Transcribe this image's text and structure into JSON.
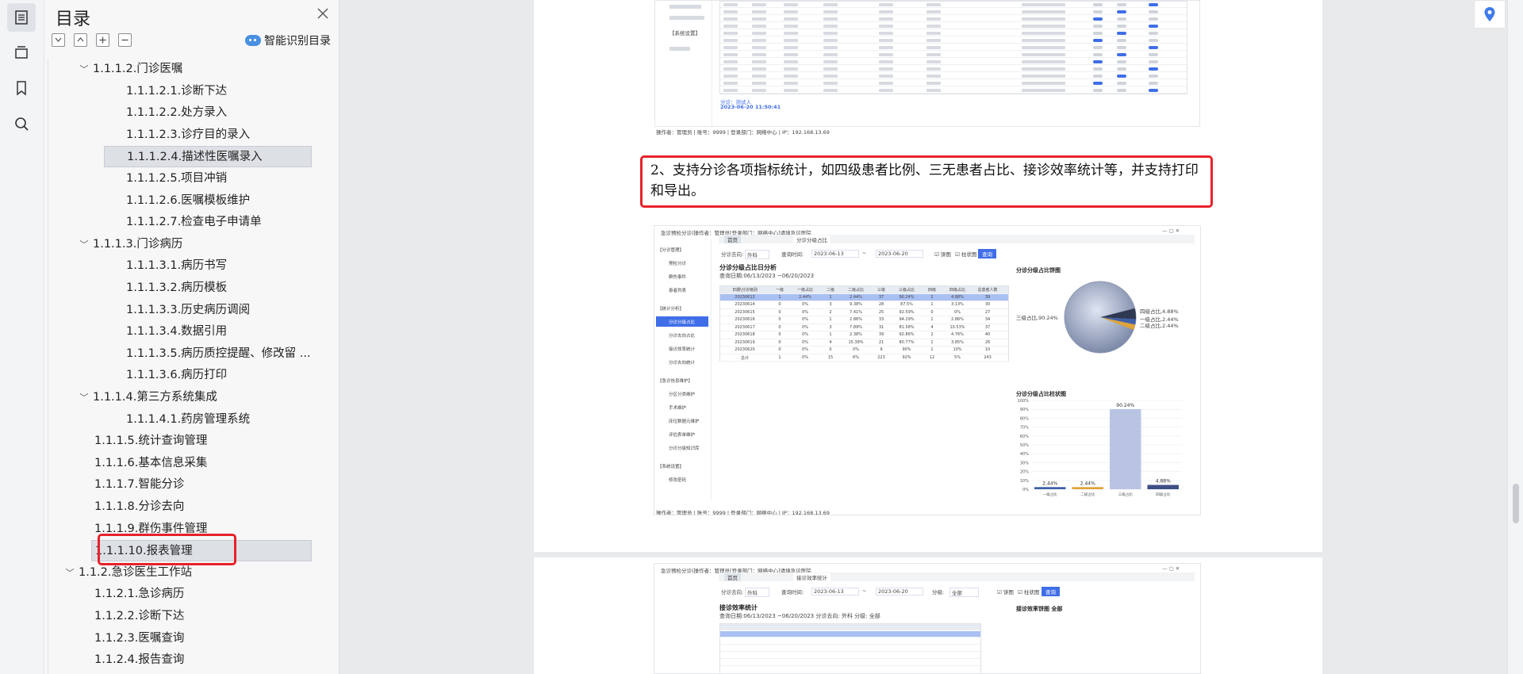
{
  "toc": {
    "title": "目录",
    "smart_label": "智能识别目录",
    "items": [
      {
        "text": "1.1.1.2.门诊医嘱",
        "level": 2,
        "expanded": true
      },
      {
        "text": "1.1.1.2.1.诊断下达",
        "level": 3
      },
      {
        "text": "1.1.1.2.2.处方录入",
        "level": 3
      },
      {
        "text": "1.1.1.2.3.诊疗目的录入",
        "level": 3
      },
      {
        "text": "1.1.1.2.4.描述性医嘱录入",
        "level": 3,
        "selected": true
      },
      {
        "text": "1.1.1.2.5.项目冲销",
        "level": 3
      },
      {
        "text": "1.1.1.2.6.医嘱模板维护",
        "level": 3
      },
      {
        "text": "1.1.1.2.7.检查电子申请单",
        "level": 3
      },
      {
        "text": "1.1.1.3.门诊病历",
        "level": 2,
        "expanded": true
      },
      {
        "text": "1.1.1.3.1.病历书写",
        "level": 3
      },
      {
        "text": "1.1.1.3.2.病历模板",
        "level": 3
      },
      {
        "text": "1.1.1.3.3.历史病历调阅",
        "level": 3
      },
      {
        "text": "1.1.1.3.4.数据引用",
        "level": 3
      },
      {
        "text": "1.1.1.3.5.病历质控提醒、修改留 ...",
        "level": 3
      },
      {
        "text": "1.1.1.3.6.病历打印",
        "level": 3
      },
      {
        "text": "1.1.1.4.第三方系统集成",
        "level": 2,
        "expanded": true
      },
      {
        "text": "1.1.1.4.1.药房管理系统",
        "level": 3
      },
      {
        "text": "1.1.1.5.统计查询管理",
        "level": 2
      },
      {
        "text": "1.1.1.6.基本信息采集",
        "level": 2
      },
      {
        "text": "1.1.1.7.智能分诊",
        "level": 2
      },
      {
        "text": "1.1.1.8.分诊去向",
        "level": 2
      },
      {
        "text": "1.1.1.9.群伤事件管理",
        "level": 2
      },
      {
        "text": "1.1.1.10.报表管理",
        "level": 2,
        "highlighted": true,
        "selected": true
      },
      {
        "text": "1.1.2.急诊医生工作站",
        "level": 1,
        "expanded": true
      },
      {
        "text": "1.1.2.1.急诊病历",
        "level": 2
      },
      {
        "text": "1.1.2.2.诊断下达",
        "level": 2
      },
      {
        "text": "1.1.2.3.医嘱查询",
        "level": 2
      },
      {
        "text": "1.1.2.4.报告查询",
        "level": 2
      }
    ]
  },
  "document": {
    "paragraph": "2、支持分诊各项指标统计，如四级患者比例、三无患者占比、接诊效率统计等，并支持打印和导出。",
    "shot1": {
      "triage_label": "分诊：测试人",
      "triage_time": "2023-06-20 11:50:41",
      "footer": "操作者：管理员 | 账号：9999 | 登录部门：网络中心 | IP：192.168.13.69"
    },
    "shot2": {
      "window_title": "急诊预检分诊(操作者：管理员[登录部门：网络中心]请填急诊医院",
      "tab_home": "首页",
      "tab_active": "分诊分级占比",
      "filter_dept_label": "分诊去向:",
      "filter_dept": "外科",
      "filter_time_label": "查询时间:",
      "date_from": "2023-06-13",
      "date_to": "2023-06-20",
      "check_pie": "饼图",
      "check_bar": "柱状图",
      "query_btn": "查询",
      "report_title": "分诊分级占比日分析",
      "report_range": "查询日期:06/13/2023 ~06/20/2023",
      "pie_title": "分诊分级占比饼图",
      "bar_title": "分诊分级占比柱状图",
      "pie_labels": {
        "l3": "三级占比,90.24%",
        "l4": "四级占比,4.88%",
        "l1": "一级占比,2.44%",
        "l2": "二级占比,2.44%"
      },
      "footer": "操作者：管理员 | 账号：9999 | 登录部门：网络中心 | IP：192.168.13.69"
    },
    "shot3": {
      "window_title": "急诊预检分诊(操作者：管理员[登录部门：网络中心]请填急诊医院",
      "tab_home": "首页",
      "tab_active": "接诊效率统计",
      "filter_dept": "外科",
      "date_from": "2023-06-13",
      "date_to": "2023-06-20",
      "level_label": "分级:",
      "level_value": "全部",
      "query_btn": "查询",
      "report_title": "接诊效率统计",
      "report_range": "查询日期:06/13/2023 ~06/20/2023  分诊去向: 外科  分级: 全部",
      "pie_title": "接诊效率饼图  全部"
    },
    "side_nav": [
      "【分诊管理】",
      "预检分诊",
      "群伤事件",
      "患者列表",
      "【统计分析】",
      "分诊分级占比",
      "分诊去向占比",
      "接诊效率统计",
      "分诊去向统计",
      "【急诊信息维护】",
      "分区分类维护",
      "手术维护",
      "床位数据元维护",
      "评估表单维护",
      "分诊分级知识库",
      "【系统设置】",
      "修改密码"
    ]
  },
  "chart_data": {
    "type": "bar",
    "title": "分诊分级占比柱状图",
    "categories": [
      "一级占比",
      "二级占比",
      "三级占比",
      "四级占比"
    ],
    "values": [
      2.44,
      2.44,
      90.24,
      4.88
    ],
    "ylim": [
      0,
      100
    ],
    "yticks": [
      "0%",
      "10%",
      "20%",
      "30%",
      "40%",
      "50%",
      "60%",
      "70%",
      "80%",
      "90%",
      "100%"
    ],
    "colors": [
      "#3f5fa8",
      "#e0a43a",
      "#b8c4e2",
      "#3d4f85"
    ]
  },
  "table": {
    "headers": [
      "日期\\分诊级别",
      "一级",
      "一级占比",
      "二级",
      "二级占比",
      "三级",
      "三级占比",
      "四级",
      "四级占比",
      "总患者人数"
    ],
    "rows": [
      [
        "20230613",
        "1",
        "2.44%",
        "1",
        "2.44%",
        "37",
        "90.24%",
        "2",
        "4.88%",
        "39"
      ],
      [
        "20230614",
        "0",
        "0%",
        "3",
        "9.38%",
        "28",
        "87.5%",
        "1",
        "3.13%",
        "30"
      ],
      [
        "20230615",
        "0",
        "0%",
        "2",
        "7.41%",
        "25",
        "92.59%",
        "0",
        "0%",
        "27"
      ],
      [
        "20230616",
        "0",
        "0%",
        "1",
        "2.86%",
        "33",
        "94.29%",
        "1",
        "2.86%",
        "34"
      ],
      [
        "20230617",
        "0",
        "0%",
        "3",
        "7.89%",
        "31",
        "81.58%",
        "4",
        "10.53%",
        "37"
      ],
      [
        "20230618",
        "0",
        "0%",
        "1",
        "2.38%",
        "39",
        "92.86%",
        "2",
        "4.76%",
        "40"
      ],
      [
        "20230619",
        "0",
        "0%",
        "4",
        "15.38%",
        "21",
        "80.77%",
        "1",
        "3.85%",
        "26"
      ],
      [
        "20230620",
        "0",
        "0%",
        "0",
        "0%",
        "9",
        "90%",
        "1",
        "10%",
        "10"
      ],
      [
        "总计",
        "1",
        "0%",
        "15",
        "6%",
        "223",
        "92%",
        "12",
        "5%",
        "243"
      ]
    ]
  }
}
